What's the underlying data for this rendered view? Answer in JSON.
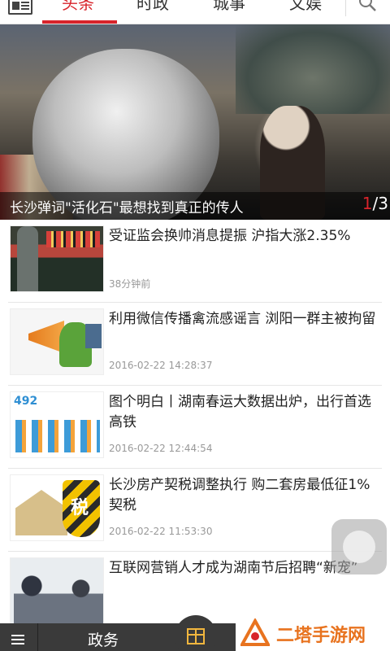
{
  "tabs": [
    {
      "label": "头条",
      "active": true
    },
    {
      "label": "时政",
      "active": false
    },
    {
      "label": "城事",
      "active": false
    },
    {
      "label": "文娱",
      "active": false
    }
  ],
  "icons": {
    "menu": "grid-menu-icon",
    "search": "search-icon",
    "bottom_menu": "hamburger-icon",
    "gift": "gift-icon"
  },
  "hero": {
    "caption": "长沙弹词\"活化石\"最想找到真正的传人",
    "current": "1",
    "total": "/3"
  },
  "news": [
    {
      "title": "受证监会换帅消息提振 沪指大涨2.35%",
      "time": "38分钟前"
    },
    {
      "title": "利用微信传播禽流感谣言 浏阳一群主被拘留",
      "time": "2016-02-22 14:28:37"
    },
    {
      "title": "图个明白丨湖南春运大数据出炉，出行首选高铁",
      "time": "2016-02-22 12:44:54"
    },
    {
      "title": "长沙房产契税调整执行 购二套房最低征1%契税",
      "time": "2016-02-22 11:53:30"
    },
    {
      "title": "互联网营销人才成为湖南节后招聘“新宠”",
      "time": ""
    }
  ],
  "thumb_text": {
    "chart_number": "492",
    "tax_glyph": "税"
  },
  "bottom": {
    "label": "政务"
  },
  "watermark": {
    "text": "二塔手游网"
  },
  "colors": {
    "accent": "#d8242b",
    "bottom_bar": "#3a3a3a",
    "watermark": "#e8731f"
  }
}
